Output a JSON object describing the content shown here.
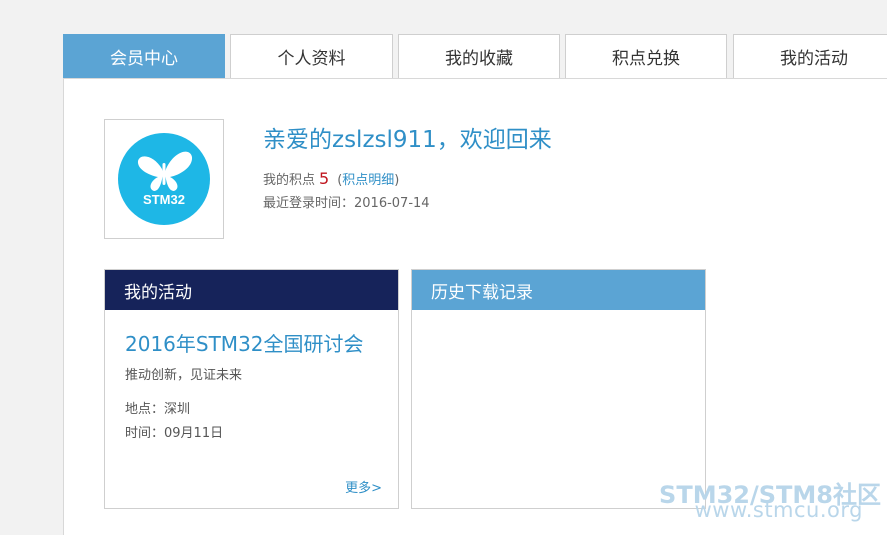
{
  "tabs": [
    {
      "label": "会员中心",
      "active": true
    },
    {
      "label": "个人资料"
    },
    {
      "label": "我的收藏"
    },
    {
      "label": "积点兑换"
    },
    {
      "label": "我的活动"
    }
  ],
  "profile": {
    "avatar_text": "STM32",
    "welcome": "亲爱的zslzsl911，欢迎回来",
    "points_label": "我的积点",
    "points_value": "5",
    "points_detail_link": "积点明细",
    "last_login": "最近登录时间：2016-07-14"
  },
  "activity_card": {
    "title": "我的活动",
    "event_title": "2016年STM32全国研讨会",
    "event_subtitle": "推动创新，见证未来",
    "location": "地点：深圳",
    "time": "时间：09月11日",
    "more_link": "更多>"
  },
  "history_card": {
    "title": "历史下载记录"
  },
  "watermark": {
    "line1": "STM32/STM8社区",
    "line2": "www.stmcu.org"
  },
  "colors": {
    "accent": "#5ba4d4",
    "link": "#2f8fc7",
    "dark_header": "#16235a",
    "points": "#c0161f"
  }
}
